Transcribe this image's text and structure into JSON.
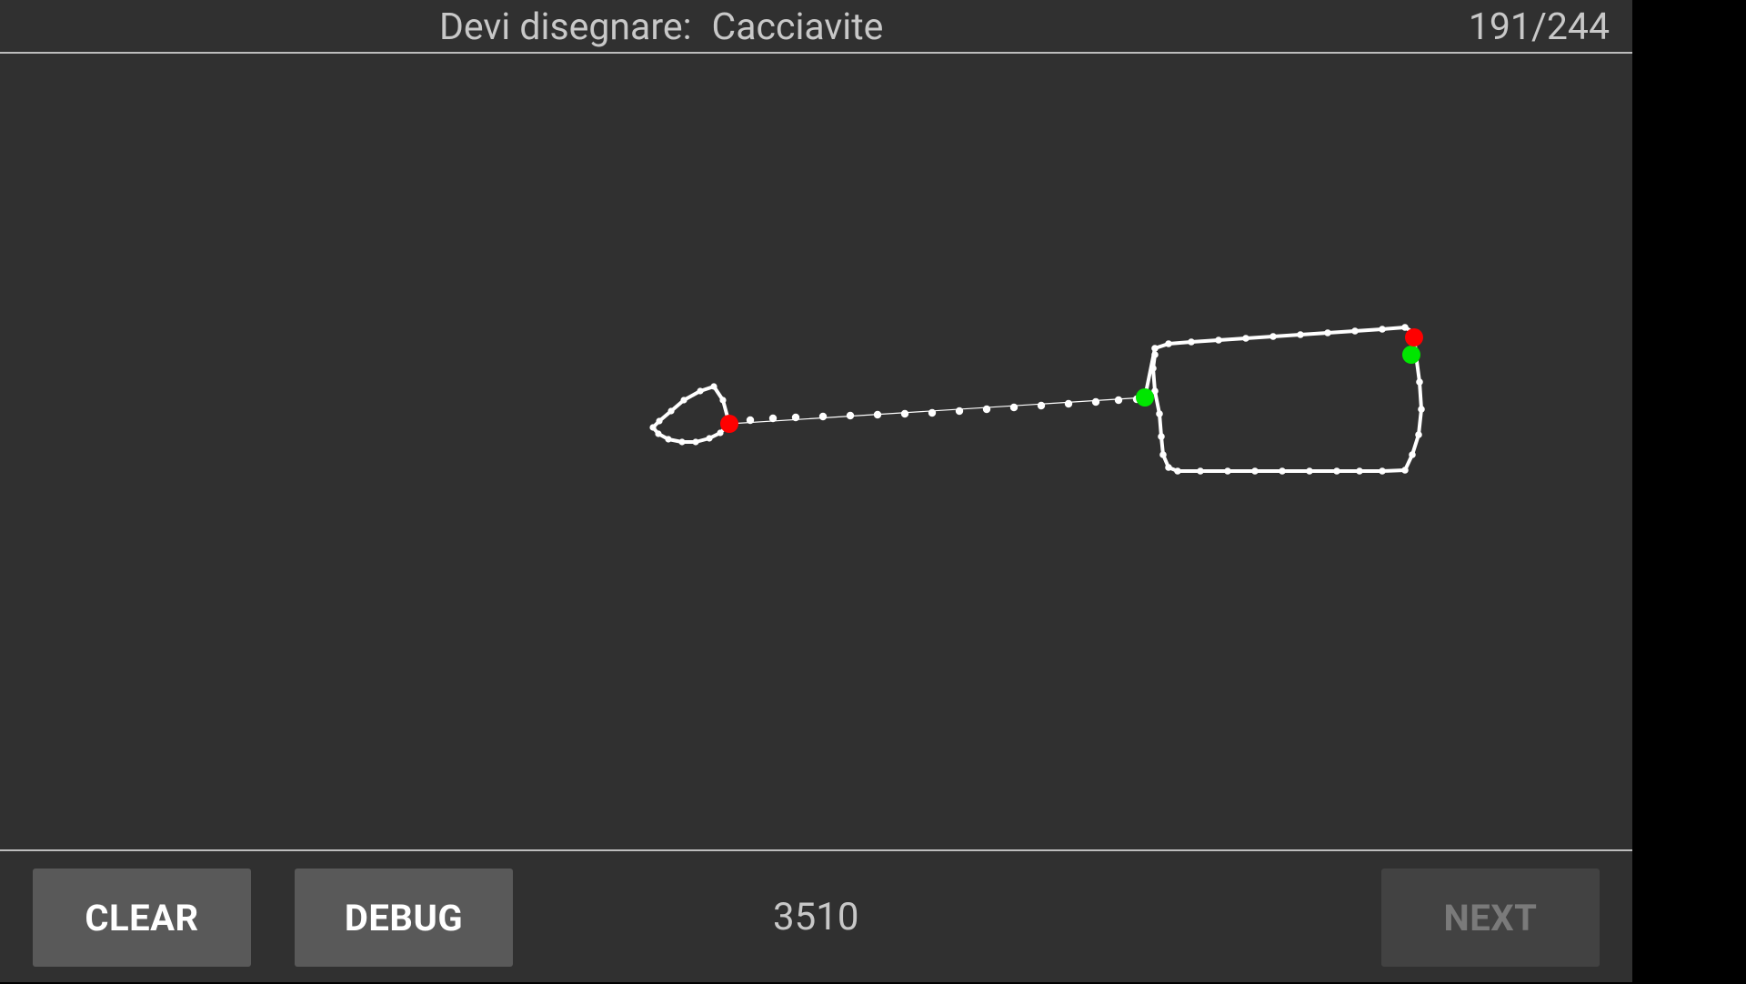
{
  "header": {
    "prompt_label": "Devi disegnare:",
    "target_word": "Cacciavite",
    "progress": "191/244"
  },
  "footer": {
    "clear_label": "CLEAR",
    "debug_label": "DEBUG",
    "score": "3510",
    "next_label": "NEXT",
    "next_enabled": false
  },
  "colors": {
    "background": "#303030",
    "stroke": "#ffffff",
    "stroke_start": "#00e600",
    "stroke_end": "#ff0000",
    "button": "#595959",
    "button_disabled": "#424242"
  }
}
